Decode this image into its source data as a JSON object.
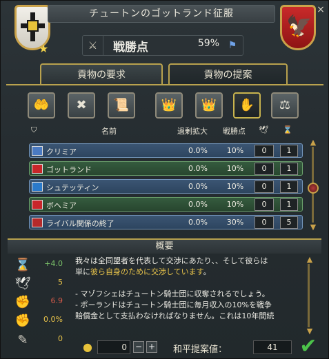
{
  "window": {
    "title": "チュートンのゴットランド征服",
    "close": "×"
  },
  "warscore": {
    "label": "戦勝点",
    "value": "59%"
  },
  "tabs": [
    {
      "label": "貢物の要求",
      "active": true
    },
    {
      "label": "貢物の提案",
      "active": false
    }
  ],
  "actions": [
    {
      "icon": "demand-provinces-icon",
      "glyph": "✋"
    },
    {
      "icon": "release-nation-icon",
      "glyph": "✖"
    },
    {
      "icon": "return-cores-icon",
      "glyph": "↺"
    },
    {
      "icon": "revoke-claims-icon",
      "glyph": "♛"
    },
    {
      "icon": "vassalize-icon",
      "glyph": "➔"
    },
    {
      "icon": "break-alliance-icon",
      "glyph": "✕",
      "active": true
    },
    {
      "icon": "tribute-icon",
      "glyph": "⇅"
    }
  ],
  "table": {
    "headers": {
      "name": "名前",
      "overextension": "過剰拡大",
      "warscore": "戦勝点"
    },
    "rows": [
      {
        "name": "クリミア",
        "overext": "0.0%",
        "warscore": "10%",
        "a": "0",
        "b": "1",
        "style": "blue",
        "flag_color": "#4a7ac2"
      },
      {
        "name": "ゴットランド",
        "overext": "0.0%",
        "warscore": "10%",
        "a": "0",
        "b": "1",
        "style": "green",
        "flag_color": "#c8262a"
      },
      {
        "name": "シュテッティン",
        "overext": "0.0%",
        "warscore": "10%",
        "a": "0",
        "b": "1",
        "style": "blue",
        "flag_color": "#2a7acb"
      },
      {
        "name": "ボヘミア",
        "overext": "0.0%",
        "warscore": "10%",
        "a": "0",
        "b": "1",
        "style": "green",
        "flag_color": "#c8262a"
      },
      {
        "name": "ライバル関係の終了",
        "overext": "0.0%",
        "warscore": "30%",
        "a": "0",
        "b": "5",
        "style": "blue",
        "flag_color": "#b52a2a"
      }
    ]
  },
  "summary": {
    "title": "概要",
    "stats": [
      {
        "icon": "prestige-icon",
        "glyph": "⌛",
        "value": "+4.0",
        "color": "#7cc46a"
      },
      {
        "icon": "diplomacy-icon",
        "glyph": "🕊",
        "value": "5",
        "color": "#e8c34a"
      },
      {
        "icon": "aggressive-expansion-icon",
        "glyph": "✊",
        "value": "6.9",
        "color": "#d45a4a"
      },
      {
        "icon": "war-reparations-icon",
        "glyph": "✊",
        "value": "0.0%",
        "color": "#e8c34a"
      },
      {
        "icon": "treaty-icon",
        "glyph": "✎",
        "value": "0",
        "color": "#e8c34a"
      }
    ],
    "text_line1": "我々は全同盟者を代表して交渉にあたり、、そして彼らは",
    "text_line2_pre": "単に",
    "text_line2_hl": "彼ら自身のために交渉しています",
    "text_line2_post": "。",
    "text_line3": "- マゾフシェはチュートン騎士団に収奪されるでしょう。",
    "text_line4": "- ポーランドはチュートン騎士団に毎月収入の10%を戦争",
    "text_line5": "賠償金として支払わなければなりません。これは10年間続"
  },
  "bottom": {
    "gold_value": "0",
    "minus": "−",
    "plus": "+",
    "peace_label": "和平提案値：",
    "peace_value": "41",
    "confirm": "✔"
  }
}
